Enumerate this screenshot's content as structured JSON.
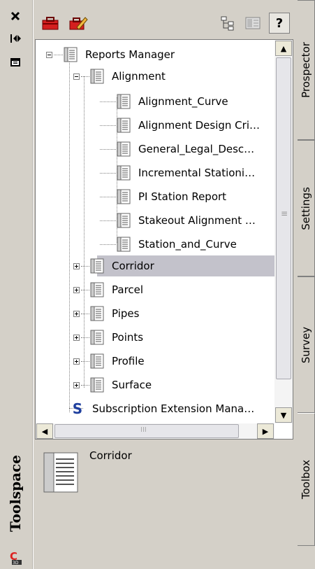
{
  "palette": {
    "panel_bg": "#d4d0c8",
    "tree_bg": "#ffffff",
    "selection": "#c3c2cb"
  },
  "left_strip": {
    "close_icon": "close-icon",
    "autohide_icon": "autohide-icon",
    "properties_icon": "properties-icon",
    "title": "Toolspace",
    "app_icon_label": "C 3D"
  },
  "toolbar": {
    "icons": [
      "toolbox-icon",
      "edit-toolbox-icon",
      "tree-view-icon",
      "list-view-icon",
      "help-icon"
    ],
    "help_label": "?"
  },
  "tree": {
    "root": "Reports Manager",
    "alignment": "Alignment",
    "alignment_children": [
      "Alignment_Curve",
      "Alignment Design Cri…",
      "General_Legal_Desc…",
      "Incremental Stationi…",
      "PI Station Report",
      "Stakeout Alignment …",
      "Station_and_Curve"
    ],
    "categories": [
      "Corridor",
      "Parcel",
      "Pipes",
      "Points",
      "Profile",
      "Surface"
    ],
    "selected": "Corridor",
    "extension": "Subscription Extension Mana…",
    "extension_icon_letter": "S"
  },
  "scroll": {
    "up": "▲",
    "down": "▼",
    "left": "◀",
    "right": "▶",
    "grip": "≡",
    "hgrip": "III"
  },
  "preview": {
    "label": "Corridor"
  },
  "tabs": [
    "Prospector",
    "Settings",
    "Survey",
    "Toolbox"
  ]
}
